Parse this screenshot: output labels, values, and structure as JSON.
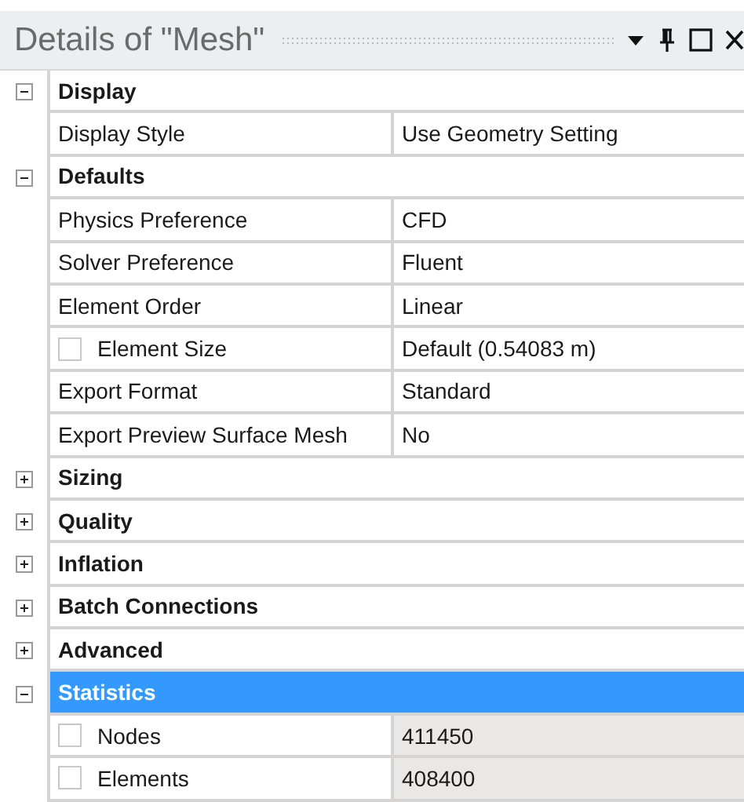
{
  "window": {
    "title": "Details of \"Mesh\""
  },
  "sections": [
    {
      "title": "Display",
      "expanded": true,
      "selected": false,
      "rows": [
        {
          "label": "Display Style",
          "value": "Use Geometry Setting",
          "readonly": false
        }
      ]
    },
    {
      "title": "Defaults",
      "expanded": true,
      "selected": false,
      "rows": [
        {
          "label": "Physics Preference",
          "value": "CFD",
          "readonly": false
        },
        {
          "label": "Solver Preference",
          "value": "Fluent",
          "readonly": false
        },
        {
          "label": "Element Order",
          "value": "Linear",
          "readonly": false
        },
        {
          "label": "Element Size",
          "value": "Default (0.54083 m)",
          "readonly": false,
          "checked": false
        },
        {
          "label": "Export Format",
          "value": "Standard",
          "readonly": false
        },
        {
          "label": "Export Preview Surface Mesh",
          "value": "No",
          "readonly": false
        }
      ]
    },
    {
      "title": "Sizing",
      "expanded": false,
      "selected": false
    },
    {
      "title": "Quality",
      "expanded": false,
      "selected": false
    },
    {
      "title": "Inflation",
      "expanded": false,
      "selected": false
    },
    {
      "title": "Batch Connections",
      "expanded": false,
      "selected": false
    },
    {
      "title": "Advanced",
      "expanded": false,
      "selected": false
    },
    {
      "title": "Statistics",
      "expanded": true,
      "selected": true,
      "rows": [
        {
          "label": "Nodes",
          "value": "411450",
          "readonly": true,
          "checked": false
        },
        {
          "label": "Elements",
          "value": "408400",
          "readonly": true,
          "checked": false
        }
      ]
    }
  ]
}
